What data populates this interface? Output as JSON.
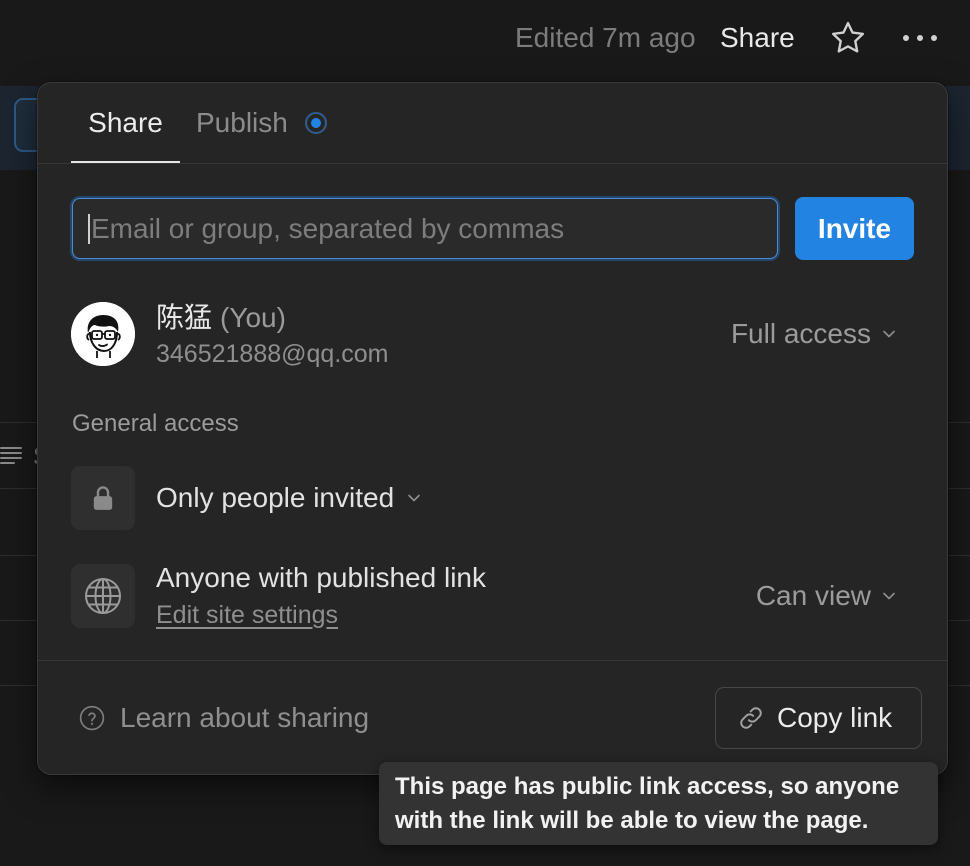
{
  "colors": {
    "page_bg": "#191919",
    "dialog_bg": "#252525",
    "accent": "#2383e2",
    "text_primary": "#e6e6e6",
    "text_secondary": "#9b9b9b",
    "tooltip_bg": "#333333"
  },
  "topbar": {
    "edited": "Edited 7m ago",
    "share_label": "Share",
    "favorite_icon": "star-icon",
    "more_icon": "more-horizontal-icon"
  },
  "background": {
    "column_icon": "text-lines-icon",
    "column_label": "S"
  },
  "dialog": {
    "tabs": [
      {
        "label": "Share",
        "active": true
      },
      {
        "label": "Publish",
        "active": false,
        "status_icon": "published-dot-icon"
      }
    ],
    "invite": {
      "placeholder": "Email or group, separated by commas",
      "value": "",
      "button_label": "Invite"
    },
    "members": [
      {
        "avatar_icon": "cartoon-avatar-icon",
        "name": "陈猛",
        "you_suffix": "(You)",
        "email": "346521888@qq.com",
        "access": "Full access"
      }
    ],
    "general_access": {
      "heading": "General access",
      "restricted": {
        "icon": "lock-icon",
        "label": "Only people invited"
      },
      "published": {
        "icon": "globe-icon",
        "label": "Anyone with published link",
        "settings_link": "Edit site settings",
        "access": "Can view"
      }
    },
    "footer": {
      "help_icon": "question-circle-icon",
      "learn_label": "Learn about sharing",
      "copy_icon": "link-icon",
      "copy_label": "Copy link"
    }
  },
  "tooltip": {
    "lines": [
      "This page has public link access, so anyone",
      "with the link will be able to view the page."
    ]
  }
}
